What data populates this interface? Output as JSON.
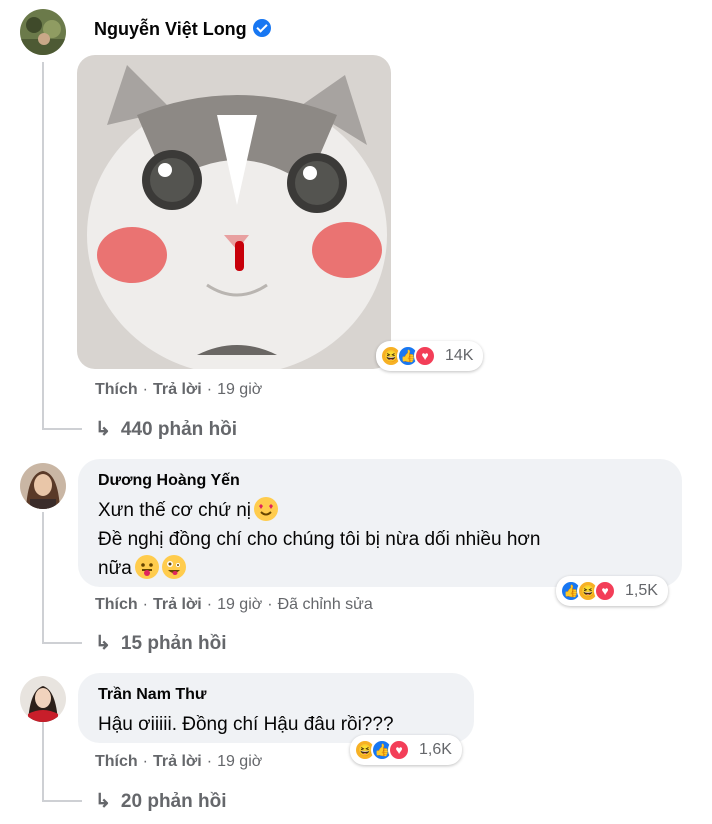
{
  "comments": [
    {
      "author": "Nguyễn Việt Long",
      "verified": true,
      "actions": {
        "like": "Thích",
        "reply": "Trả lời",
        "time": "19 giờ"
      },
      "reactions": {
        "icons": [
          "haha",
          "like",
          "love"
        ],
        "count": "14K"
      },
      "replies": "440 phản hồi"
    },
    {
      "author": "Dương Hoàng Yến",
      "line1": "Xưn thế cơ chứ nị",
      "line2": "Đề nghị đồng chí cho chúng tôi bị nừa dối nhiều hơn",
      "line3": "nữa",
      "actions": {
        "like": "Thích",
        "reply": "Trả lời",
        "time": "19 giờ",
        "edited": "Đã chỉnh sửa"
      },
      "reactions": {
        "icons": [
          "like",
          "haha",
          "love"
        ],
        "count": "1,5K"
      },
      "replies": "15 phản hồi"
    },
    {
      "author": "Trần Nam Thư",
      "line1": "Hậu ơiiiii. Đồng chí Hậu đâu rồi???",
      "actions": {
        "like": "Thích",
        "reply": "Trả lời",
        "time": "19 giờ"
      },
      "reactions": {
        "icons": [
          "haha",
          "like",
          "love"
        ],
        "count": "1,6K"
      },
      "replies": "20 phản hồi"
    }
  ],
  "separator": "·",
  "reply_arrow": "↳",
  "colors": {
    "like": "#1877f2",
    "love": "#f33e58",
    "haha": "#f7b125",
    "bubble": "#f0f2f5",
    "meta": "#65676b"
  }
}
